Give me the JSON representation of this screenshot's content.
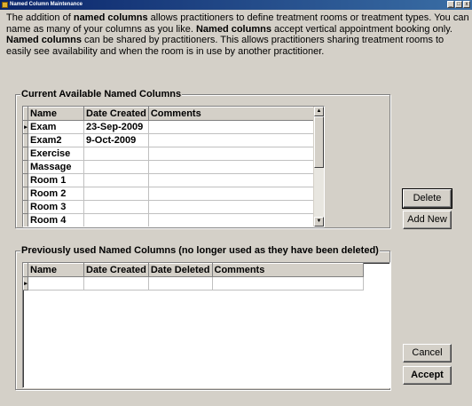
{
  "window": {
    "title": "Named Column Maintenance",
    "controls": [
      "_",
      "□",
      "x"
    ]
  },
  "intro": {
    "segments": [
      {
        "text": "The addition of ",
        "bold": false
      },
      {
        "text": "named columns",
        "bold": true
      },
      {
        "text": " allows practitioners to define treatment rooms or treatment types. You can name as many of your columns as you like.  ",
        "bold": false
      },
      {
        "text": "Named columns",
        "bold": true
      },
      {
        "text": " accept vertical appointment booking only. ",
        "bold": false
      },
      {
        "text": "Named columns",
        "bold": true
      },
      {
        "text": " can be shared by practitioners. This allows practitioners sharing treatment rooms to easily see availability and when the room is in use by another practitioner.",
        "bold": false
      }
    ]
  },
  "current": {
    "title": "Current Available Named Columns",
    "columns": [
      "Name",
      "Date Created",
      "Comments"
    ],
    "rows": [
      {
        "name": "Exam",
        "date": "23-Sep-2009",
        "comments": ""
      },
      {
        "name": "Exam2",
        "date": "9-Oct-2009",
        "comments": ""
      },
      {
        "name": "Exercise",
        "date": "",
        "comments": ""
      },
      {
        "name": "Massage",
        "date": "",
        "comments": ""
      },
      {
        "name": "Room 1",
        "date": "",
        "comments": ""
      },
      {
        "name": "Room 2",
        "date": "",
        "comments": ""
      },
      {
        "name": "Room 3",
        "date": "",
        "comments": ""
      },
      {
        "name": "Room 4",
        "date": "",
        "comments": ""
      }
    ],
    "current_row_marker": "▸"
  },
  "previous": {
    "title": "Previously used Named Columns (no longer used as they have been deleted)",
    "columns": [
      "Name",
      "Date Created",
      "Date Deleted",
      "Comments"
    ],
    "rows": [
      {
        "name": "",
        "date": "",
        "deleted": "",
        "comments": ""
      }
    ]
  },
  "buttons": {
    "delete": "Delete",
    "add_new": "Add New",
    "cancel": "Cancel",
    "accept": "Accept"
  }
}
